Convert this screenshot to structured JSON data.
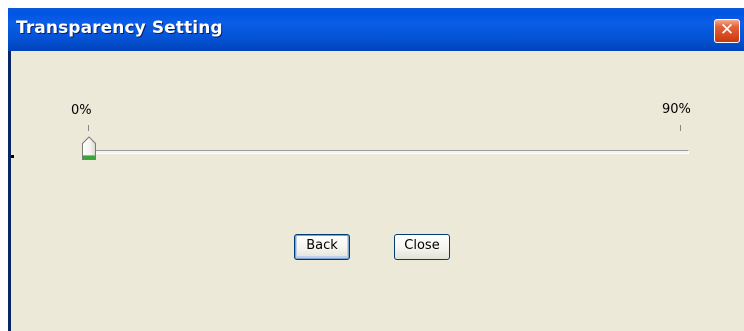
{
  "window": {
    "title": "Transparency Setting",
    "close_glyph": "✕",
    "close_icon": "close-icon"
  },
  "slider": {
    "min_label": "0%",
    "max_label": "90%",
    "value_fraction": 0,
    "thumb_color": "#3aa53a"
  },
  "buttons": {
    "back_label": "Back",
    "close_label": "Close"
  },
  "colors": {
    "title_bar": "#0054e3",
    "panel": "#ece9d8",
    "close_button": "#d9491d"
  }
}
